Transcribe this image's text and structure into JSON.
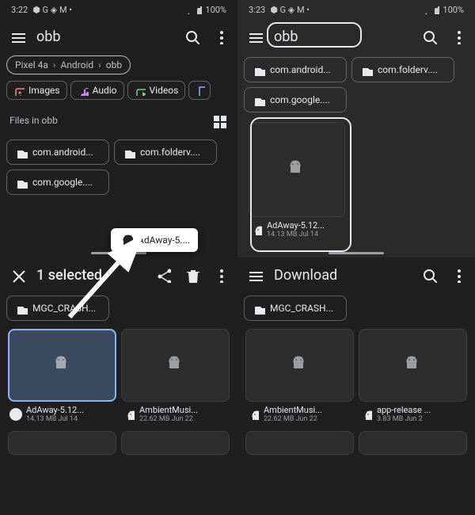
{
  "q1": {
    "time": "3:22",
    "status_icons": "⬢ G ◈ M •",
    "battery": "100%",
    "search": "obb",
    "breadcrumb": [
      "Pixel 4a",
      "Android",
      "obb"
    ],
    "chips": [
      {
        "icon": "image",
        "label": "Images",
        "color": "#f28b82"
      },
      {
        "icon": "audio",
        "label": "Audio",
        "color": "#c58af9"
      },
      {
        "icon": "video",
        "label": "Videos",
        "color": "#81c995"
      },
      {
        "icon": "doc",
        "label": "",
        "color": "#8ab4f8"
      }
    ],
    "section": "Files in obb",
    "folders": [
      "com.android...",
      "com.folderv....",
      "com.google...."
    ],
    "drag_label": "AdAway-5...."
  },
  "q2": {
    "time": "3:23",
    "status_icons": "⬢ G ◈ M •",
    "battery": "100%",
    "search": "obb",
    "folders": [
      "com.android...",
      "com.folderv....",
      "com.google...."
    ],
    "file": {
      "name": "AdAway-5.12...",
      "meta": "14.13 MB Jul 14"
    }
  },
  "q3": {
    "title": "1 selected",
    "folders": [
      "MGC_CRASH..."
    ],
    "files": [
      {
        "name": "AdAway-5.12...",
        "meta": "14.13 MB Jul 14",
        "selected": true
      },
      {
        "name": "AmbientMusi...",
        "meta": "22.62 MB Jun 22",
        "selected": false
      }
    ]
  },
  "q4": {
    "title": "Download",
    "folders": [
      "MGC_CRASH..."
    ],
    "files": [
      {
        "name": "AmbientMusi...",
        "meta": "22.62 MB Jun 22"
      },
      {
        "name": "app-release ...",
        "meta": "3.83 MB Jun 2"
      }
    ]
  }
}
